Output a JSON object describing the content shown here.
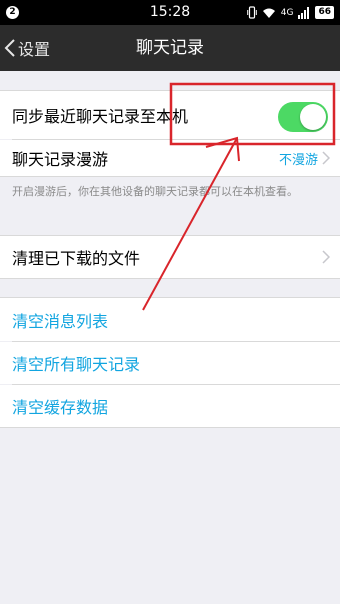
{
  "status_bar": {
    "badge": "2",
    "time": "15:28",
    "network": "4G",
    "battery": "66"
  },
  "nav": {
    "back_label": "设置",
    "title": "聊天记录"
  },
  "settings": {
    "sync_label": "同步最近聊天记录至本机",
    "sync_enabled": true,
    "roaming_label": "聊天记录漫游",
    "roaming_value": "不漫游",
    "roaming_note": "开启漫游后，你在其他设备的聊天记录都可以在本机查看。",
    "clean_files_label": "清理已下载的文件",
    "clear_message_list": "清空消息列表",
    "clear_all_chats": "清空所有聊天记录",
    "clear_cache": "清空缓存数据"
  },
  "colors": {
    "accent_blue": "#12a5e0",
    "toggle_on": "#4cd964",
    "annotation_red": "#d9252b"
  }
}
